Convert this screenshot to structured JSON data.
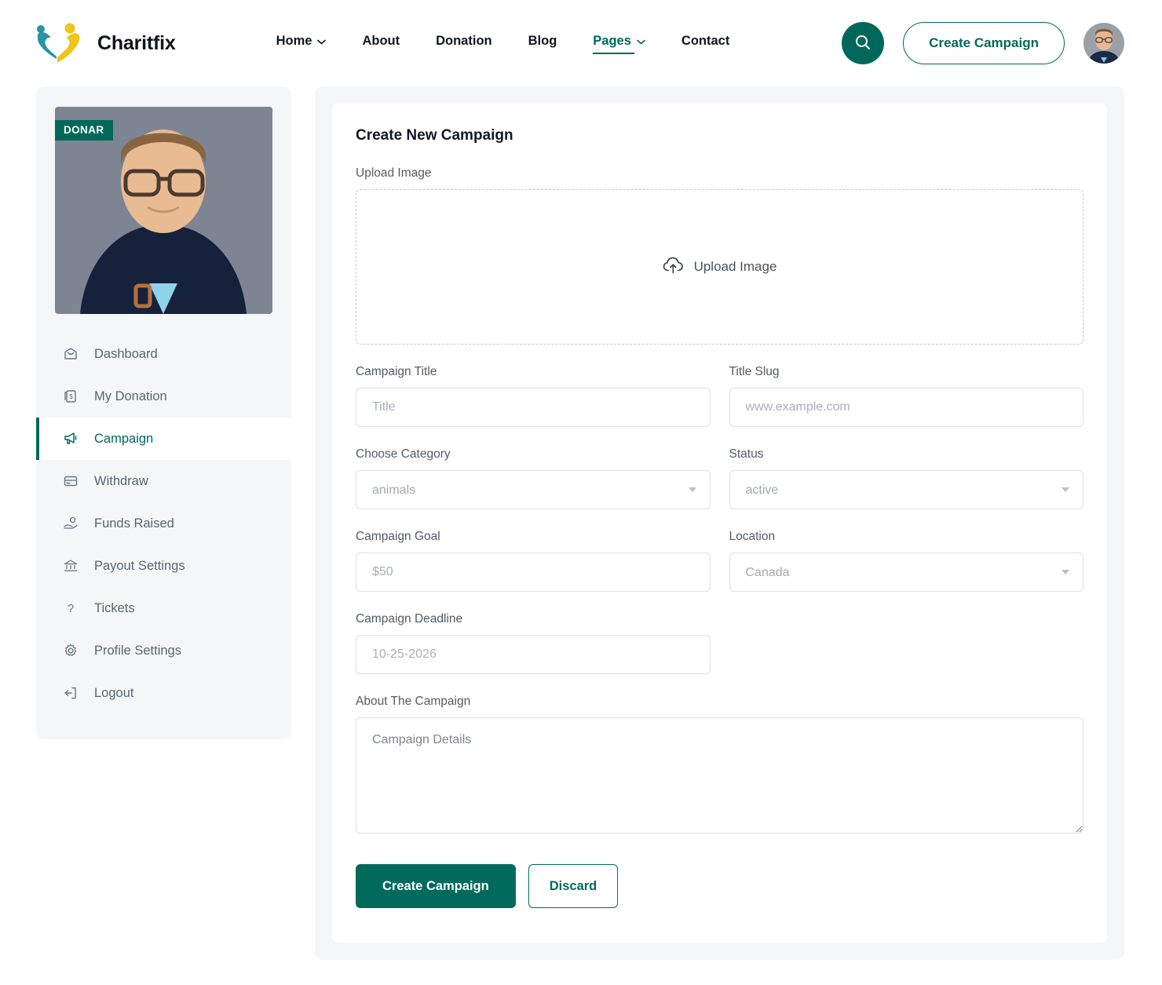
{
  "brand": {
    "name": "Charitfix",
    "logo_icon": "heart-person-logo"
  },
  "nav": {
    "items": [
      {
        "label": "Home",
        "has_caret": true,
        "active": false
      },
      {
        "label": "About",
        "has_caret": false,
        "active": false
      },
      {
        "label": "Donation",
        "has_caret": false,
        "active": false
      },
      {
        "label": "Blog",
        "has_caret": false,
        "active": false
      },
      {
        "label": "Pages",
        "has_caret": true,
        "active": true
      },
      {
        "label": "Contact",
        "has_caret": false,
        "active": false
      }
    ]
  },
  "header_actions": {
    "search_icon": "search-icon",
    "cta_label": "Create Campaign",
    "avatar_icon": "user-avatar"
  },
  "sidebar": {
    "badge": "DONAR",
    "items": [
      {
        "label": "Dashboard",
        "icon": "home-icon",
        "active": false
      },
      {
        "label": "My Donation",
        "icon": "donation-icon",
        "active": false
      },
      {
        "label": "Campaign",
        "icon": "megaphone-icon",
        "active": true
      },
      {
        "label": "Withdraw",
        "icon": "card-icon",
        "active": false
      },
      {
        "label": "Funds Raised",
        "icon": "hand-coin-icon",
        "active": false
      },
      {
        "label": "Payout Settings",
        "icon": "bank-icon",
        "active": false
      },
      {
        "label": "Tickets",
        "icon": "question-icon",
        "active": false
      },
      {
        "label": "Profile Settings",
        "icon": "gear-icon",
        "active": false
      },
      {
        "label": "Logout",
        "icon": "logout-icon",
        "active": false
      }
    ]
  },
  "form": {
    "title": "Create New Campaign",
    "upload": {
      "label": "Upload Image",
      "dropzone_label": "Upload Image",
      "icon": "cloud-upload-icon"
    },
    "campaign_title": {
      "label": "Campaign Title",
      "placeholder": "Title",
      "value": ""
    },
    "title_slug": {
      "label": "Title Slug",
      "placeholder": "www.example.com",
      "value": ""
    },
    "category": {
      "label": "Choose Category",
      "value": "animals",
      "options": [
        "animals"
      ]
    },
    "status": {
      "label": "Status",
      "value": "active",
      "options": [
        "active"
      ]
    },
    "goal": {
      "label": "Campaign Goal",
      "placeholder": "$50",
      "value": ""
    },
    "location": {
      "label": "Location",
      "value": "Canada",
      "options": [
        "Canada"
      ]
    },
    "deadline": {
      "label": "Campaign Deadline",
      "placeholder": "10-25-2026",
      "value": ""
    },
    "about": {
      "label": "About The Campaign",
      "placeholder": "Campaign Details",
      "value": ""
    },
    "submit_label": "Create Campaign",
    "discard_label": "Discard"
  },
  "colors": {
    "brand_teal": "#00685a",
    "button_teal": "#006b5b",
    "panel_bg": "#f5f6f8",
    "logo_blue": "#1f8fa4",
    "logo_yellow": "#f0c419"
  }
}
